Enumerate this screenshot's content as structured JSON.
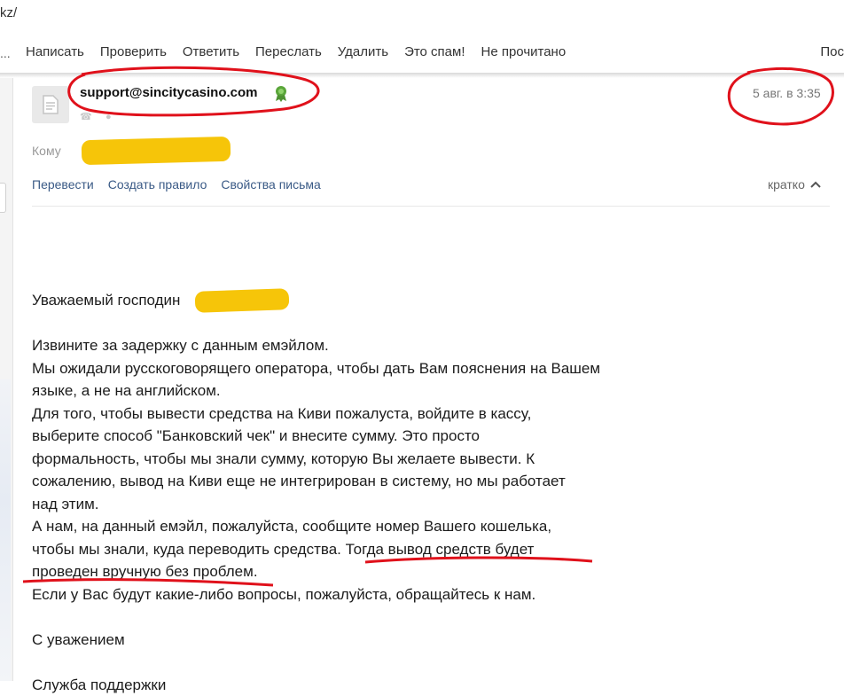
{
  "browser": {
    "url_fragment": "kz/"
  },
  "toolbar": {
    "left_cut": "...",
    "items": [
      "Написать",
      "Проверить",
      "Ответить",
      "Переслать",
      "Удалить",
      "Это спам!",
      "Не прочитано"
    ],
    "right_cut": "Пос"
  },
  "message": {
    "sender": "support@sincitycasino.com",
    "date": "5 авг. в 3:35",
    "to_label": "Кому",
    "actions": [
      "Перевести",
      "Создать правило",
      "Свойства письма"
    ],
    "collapse_label": "кратко",
    "body": {
      "greeting": "Уважаемый господин",
      "lines": [
        "Извините за задержку с данным емэйлом.",
        "Мы ожидали русскоговорящего оператора, чтобы дать Вам пояснения на Вашем",
        "языке, а не на английском.",
        "Для того, чтобы вывести средства на Киви пожалуста, войдите в кассу,",
        "выберите способ \"Банковский чек\" и внесите сумму. Это просто",
        "формальность, чтобы мы знали сумму, которую Вы желаете вывести. К",
        "сожалению, вывод на Киви еще не интегрирован в систему, но мы работает",
        "над этим.",
        "А нам, на данный емэйл, пожалуйста, сообщите номер Вашего кошелька,",
        "чтобы мы знали, куда переводить средства. Тогда вывод средств будет",
        "проведен вручную без проблем.",
        "Если у Вас будут какие-либо вопросы, пожалуйста, обращайтесь к нам."
      ],
      "closing": "С уважением",
      "signature": "Служба поддержки"
    }
  },
  "colors": {
    "link": "#3a5a86",
    "annotation_red": "#e0111b",
    "redaction_yellow": "#f6c509",
    "verified_green": "#5aa63a"
  }
}
